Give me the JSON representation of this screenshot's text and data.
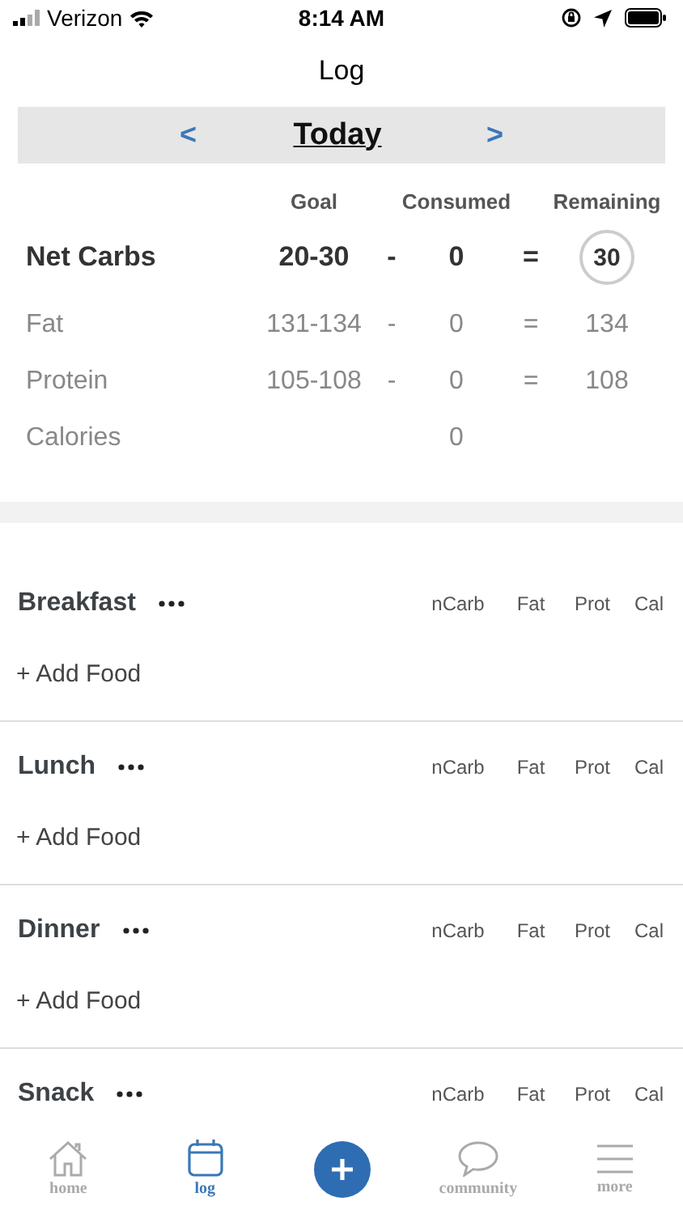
{
  "status_bar": {
    "carrier": "Verizon",
    "time": "8:14 AM"
  },
  "title": "Log",
  "date_nav": {
    "prev": "<",
    "label": "Today",
    "next": ">"
  },
  "macros": {
    "columns": {
      "goal": "Goal",
      "consumed": "Consumed",
      "remaining": "Remaining"
    },
    "rows": [
      {
        "kind": "primary",
        "name": "Net Carbs",
        "goal": "20-30",
        "minus": "-",
        "consumed": "0",
        "equals": "=",
        "remaining": "30"
      },
      {
        "kind": "plain",
        "name": "Fat",
        "goal": "131-134",
        "minus": "-",
        "consumed": "0",
        "equals": "=",
        "remaining": "134"
      },
      {
        "kind": "plain",
        "name": "Protein",
        "goal": "105-108",
        "minus": "-",
        "consumed": "0",
        "equals": "=",
        "remaining": "108"
      },
      {
        "kind": "plain",
        "name": "Calories",
        "consumed": "0"
      }
    ]
  },
  "meals": [
    {
      "name": "Breakfast",
      "columns": [
        "nCarb",
        "Fat",
        "Prot",
        "Cal"
      ],
      "add_food": "+ Add Food"
    },
    {
      "name": "Lunch",
      "columns": [
        "nCarb",
        "Fat",
        "Prot",
        "Cal"
      ],
      "add_food": "+ Add Food"
    },
    {
      "name": "Dinner",
      "columns": [
        "nCarb",
        "Fat",
        "Prot",
        "Cal"
      ],
      "add_food": "+ Add Food"
    },
    {
      "name": "Snack",
      "columns": [
        "nCarb",
        "Fat",
        "Prot",
        "Cal"
      ]
    }
  ],
  "tabs": [
    {
      "label": "home",
      "selected": false
    },
    {
      "label": "log",
      "selected": true
    },
    {
      "label": "community",
      "selected": false
    },
    {
      "label": "more",
      "selected": false
    }
  ]
}
